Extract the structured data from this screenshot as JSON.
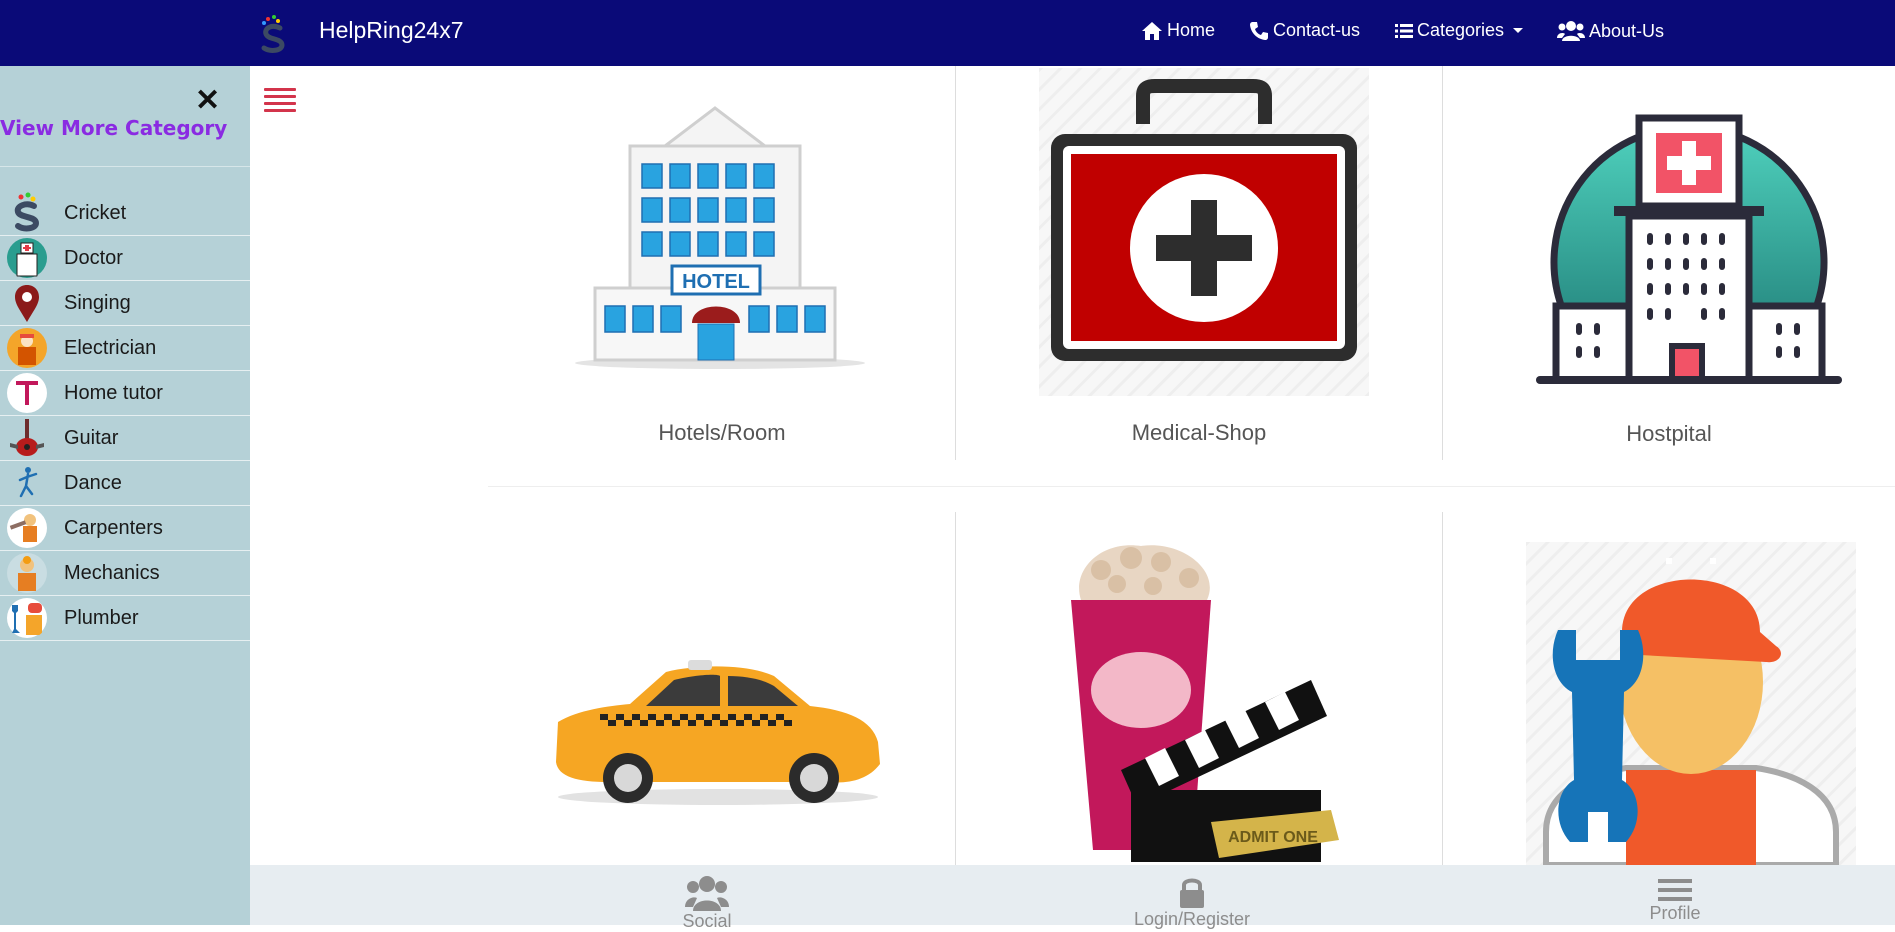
{
  "navbar": {
    "brand": "HelpRing24x7",
    "links": [
      {
        "label": "Home",
        "icon": "home-icon"
      },
      {
        "label": "Contact-us",
        "icon": "phone-icon"
      },
      {
        "label": "Categories",
        "icon": "list-icon"
      },
      {
        "label": "About-Us",
        "icon": "users-icon"
      }
    ]
  },
  "sidebar": {
    "close_label": "✕",
    "title": "View More Category",
    "items": [
      {
        "label": "Cricket",
        "icon": "cricket-logo-icon"
      },
      {
        "label": "Doctor",
        "icon": "hospital-icon"
      },
      {
        "label": "Singing",
        "icon": "map-pin-icon"
      },
      {
        "label": "Electrician",
        "icon": "electrician-icon"
      },
      {
        "label": "Home tutor",
        "icon": "tutor-t-icon"
      },
      {
        "label": "Guitar",
        "icon": "guitar-icon"
      },
      {
        "label": "Dance",
        "icon": "dancer-icon"
      },
      {
        "label": "Carpenters",
        "icon": "carpenter-icon"
      },
      {
        "label": "Mechanics",
        "icon": "mechanic-icon"
      },
      {
        "label": "Plumber",
        "icon": "plumber-icon"
      }
    ]
  },
  "categories": [
    {
      "label": "Hotels/Room",
      "icon": "hotel-icon"
    },
    {
      "label": "Medical-Shop",
      "icon": "medical-kit-icon"
    },
    {
      "label": "Hostpital",
      "icon": "hospital-building-icon"
    },
    {
      "label": "",
      "icon": "taxi-icon"
    },
    {
      "label": "",
      "icon": "cinema-icon"
    },
    {
      "label": "",
      "icon": "mechanic-wrench-icon"
    }
  ],
  "bottom_bar": {
    "social": "Social",
    "login": "Login/Register",
    "profile": "Profile"
  },
  "colors": {
    "navbar": "#0a0a78",
    "sidebar": "#b5d1d7",
    "sidebar_title": "#8a2be2",
    "menu_toggle": "#d3344b",
    "bottom_bar": "#e7edf1"
  }
}
